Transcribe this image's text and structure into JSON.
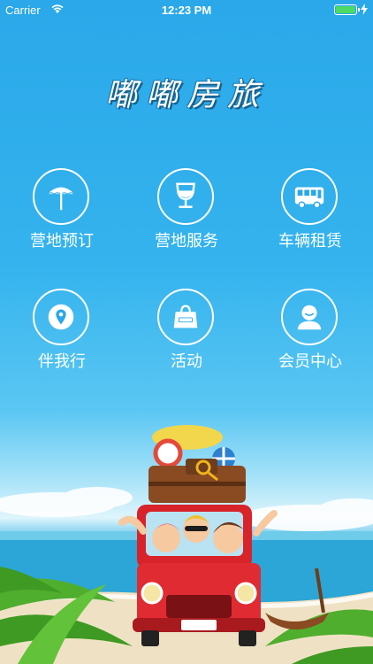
{
  "status_bar": {
    "carrier": "Carrier",
    "time": "12:23 PM"
  },
  "app": {
    "title": "嘟嘟房旅"
  },
  "menu": [
    {
      "label": "营地预订",
      "icon": "umbrella-icon"
    },
    {
      "label": "营地服务",
      "icon": "wine-glass-icon"
    },
    {
      "label": "车辆租赁",
      "icon": "bus-icon"
    },
    {
      "label": "伴我行",
      "icon": "map-pin-icon"
    },
    {
      "label": "活动",
      "icon": "shopping-bag-icon"
    },
    {
      "label": "会员中心",
      "icon": "user-icon"
    }
  ],
  "colors": {
    "sky": "#2aa8e9",
    "icon_white": "#ffffff",
    "car_red": "#d8232a",
    "palm_green": "#4fae2d"
  }
}
